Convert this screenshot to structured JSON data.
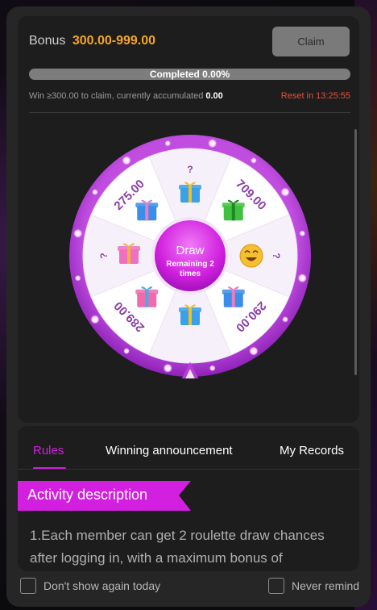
{
  "header": {
    "bonus_label": "Bonus",
    "bonus_range": "300.00-999.00",
    "claim_label": "Claim"
  },
  "progress": {
    "text": "Completed 0.00%",
    "fraction": 0.0
  },
  "claim_info": {
    "text": "Win ≥300.00 to claim, currently accumulated",
    "accumulated": "0.00",
    "reset_text": "Reset in 13:25:55"
  },
  "wheel": {
    "center_title": "Draw",
    "remaining": "Remaining  2 times",
    "segments": [
      {
        "label": "?",
        "icon": "gift-box-open-icon"
      },
      {
        "label": "709.00",
        "icon": "green-gift-icon"
      },
      {
        "label": "?",
        "icon": "laughing-emoji-icon"
      },
      {
        "label": "290.00",
        "icon": "blue-gift-icon"
      },
      {
        "label": "",
        "icon": "gift-box-open-icon"
      },
      {
        "label": "289.00",
        "icon": "pink-gift-icon"
      },
      {
        "label": "?",
        "icon": "pink-gift-bow-icon"
      },
      {
        "label": "275.00",
        "icon": "blue-gift-icon"
      }
    ],
    "colors": {
      "rim": "#b53ed6",
      "accent": "#d21fe0",
      "label": "#8a3ea8"
    }
  },
  "tabs": [
    {
      "label": "Rules",
      "active": true
    },
    {
      "label": "Winning announcement",
      "active": false
    },
    {
      "label": "My Records",
      "active": false
    }
  ],
  "activity": {
    "ribbon": "Activity description",
    "description": "1.Each member can get 2 roulette draw chances after logging in, with a maximum bonus of"
  },
  "footer": {
    "dont_show": "Don't show again today",
    "never_remind": "Never remind"
  }
}
